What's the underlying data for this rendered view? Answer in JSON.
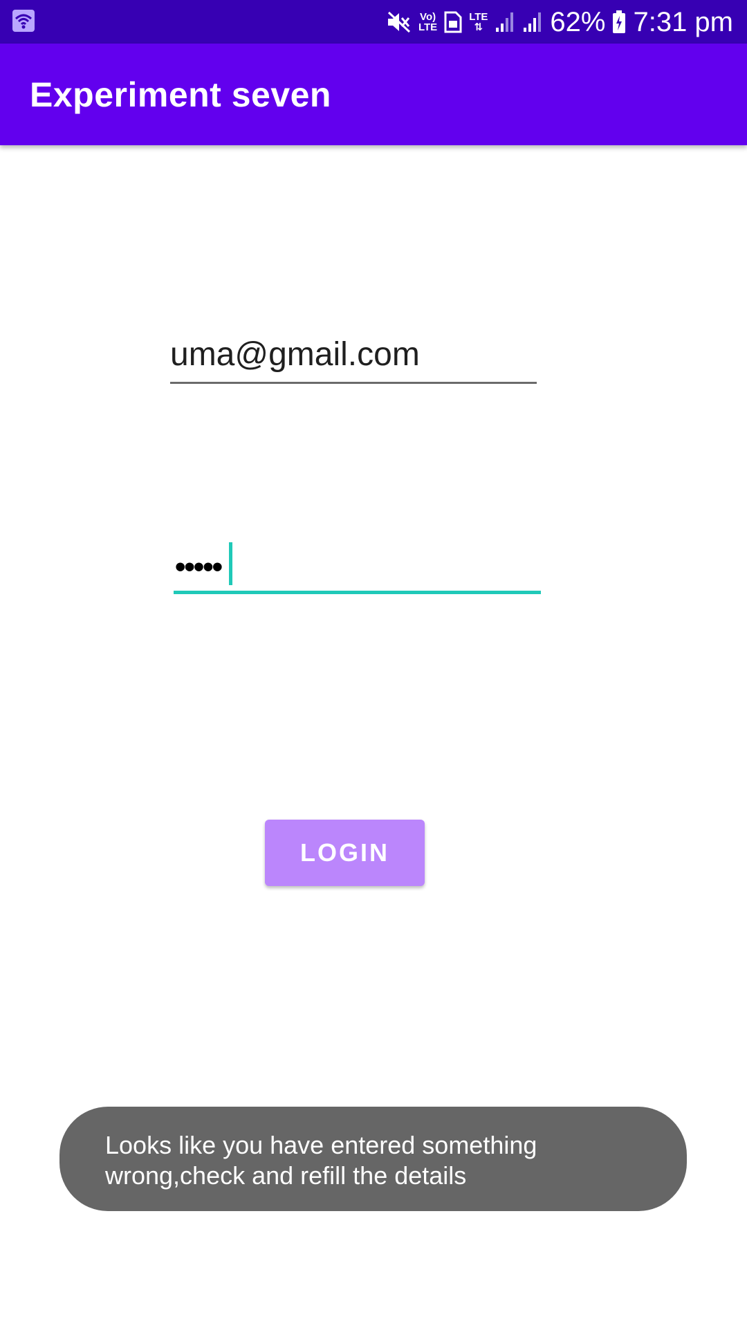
{
  "status_bar": {
    "battery_percent": "62%",
    "time": "7:31 pm",
    "volte_top": "Vo)",
    "volte_bottom": "LTE",
    "lte_label": "LTE",
    "icons": [
      "wifi-icon",
      "mute-icon",
      "volte-icon",
      "sim-icon",
      "lte-icon",
      "signal-icon",
      "signal-icon",
      "battery-charging-icon"
    ]
  },
  "app_bar": {
    "title": "Experiment seven"
  },
  "form": {
    "email_value": "uma@gmail.com",
    "password_mask": "•••••"
  },
  "login_button": {
    "label": "LOGIN"
  },
  "toast": {
    "line1": "Looks like you have entered something",
    "line2": "wrong,check and refill the details"
  },
  "colors": {
    "status_bar": "#3700b3",
    "app_bar": "#6200ee",
    "accent": "#20c9b8",
    "button": "#bb86fc",
    "toast": "#666666"
  }
}
